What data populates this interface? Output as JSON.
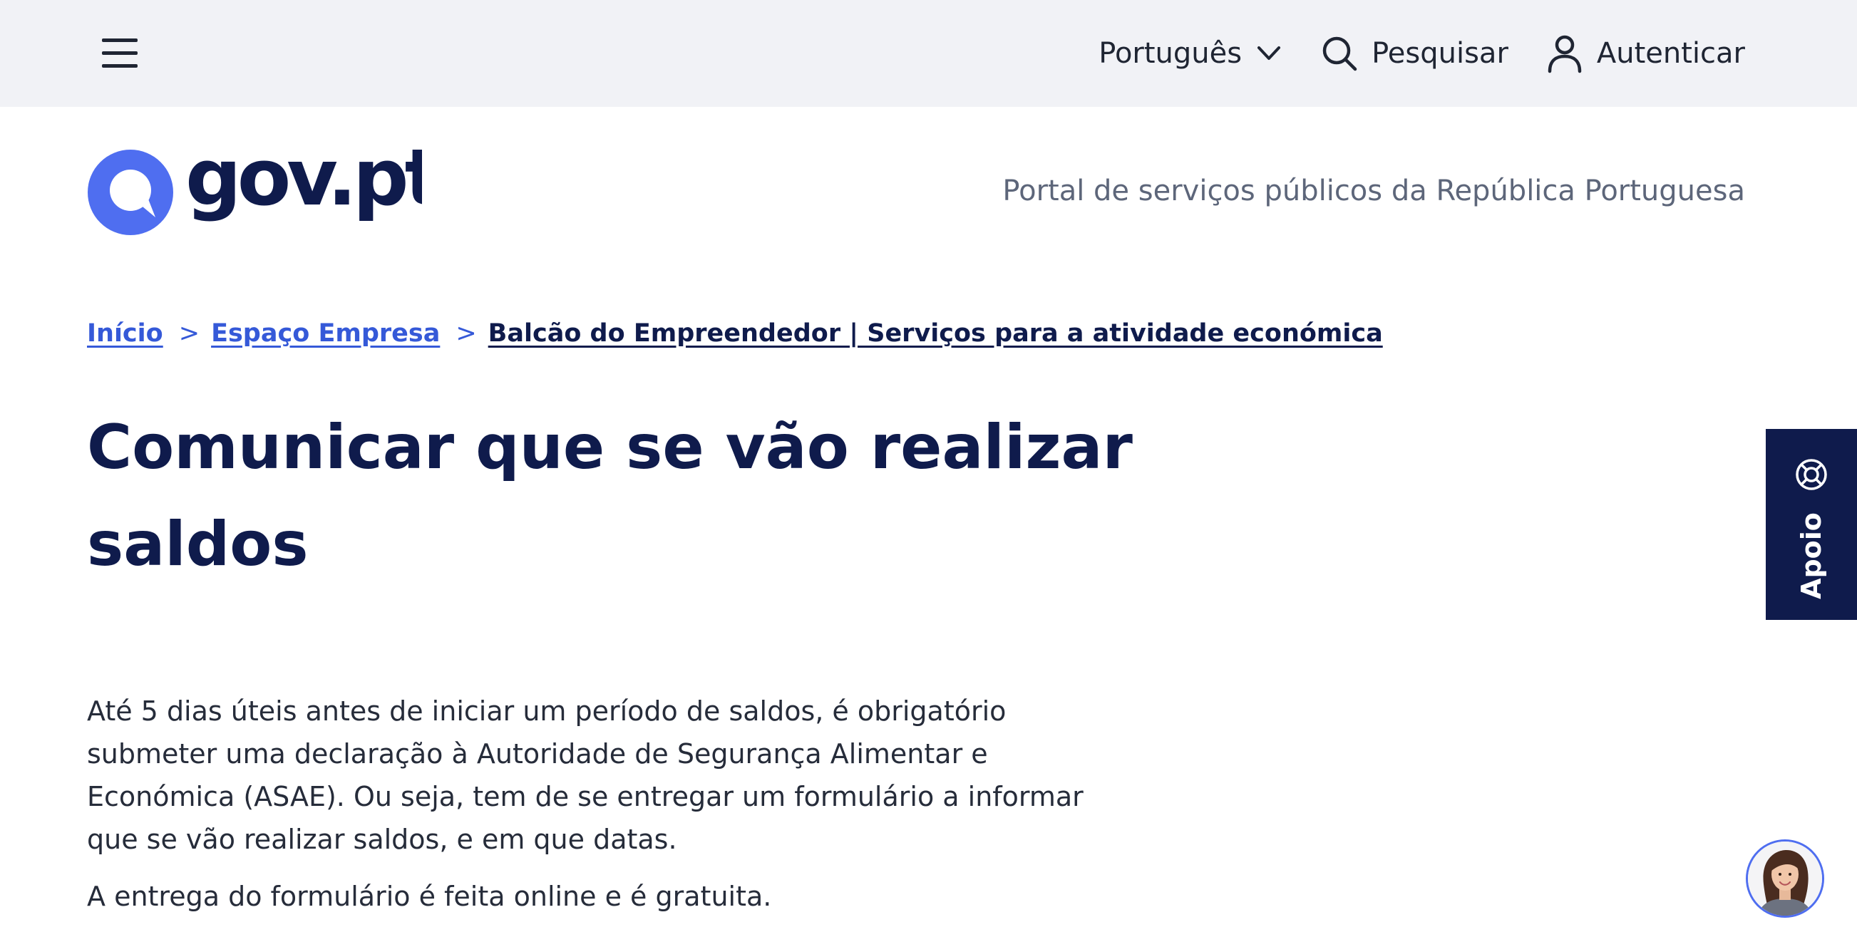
{
  "topbar": {
    "menu_icon": "hamburger-menu-icon",
    "language_label": "Português",
    "language_icon": "chevron-down-icon",
    "search_label": "Pesquisar",
    "search_icon": "search-icon",
    "login_label": "Autenticar",
    "login_icon": "user-icon"
  },
  "header": {
    "logo_text": "gov.pt",
    "tagline": "Portal de serviços públicos da República Portuguesa"
  },
  "breadcrumb": {
    "items": [
      "Início",
      "Espaço Empresa",
      "Balcão do Empreendedor | Serviços para a atividade económica"
    ],
    "separator": ">"
  },
  "page": {
    "title": "Comunicar que se vão realizar saldos",
    "paragraphs": [
      "Até 5 dias úteis antes de iniciar um período de saldos, é obrigatório submeter uma declaração à Autoridade de Segurança Alimentar e Económica (ASAE). Ou seja, tem de se entregar um formulário a informar que se vão realizar saldos, e em que datas.",
      "A entrega do formulário é feita online e é gratuita."
    ]
  },
  "support": {
    "label": "Apoio",
    "icon": "lifebuoy-icon"
  },
  "chat": {
    "icon": "assistant-avatar"
  },
  "colors": {
    "brand_blue": "#4f6ef0",
    "navy": "#0f1b4c",
    "link_blue": "#3559d8",
    "topbar_bg": "#f1f2f6"
  }
}
